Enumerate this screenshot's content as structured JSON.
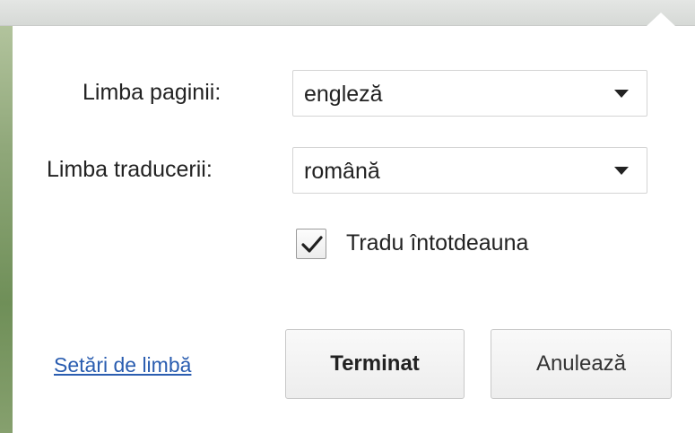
{
  "dialog": {
    "page_language_label": "Limba paginii:",
    "page_language_value": "engleză",
    "translation_language_label": "Limba traducerii:",
    "translation_language_value": "română",
    "always_translate_label": "Tradu întotdeauna",
    "always_translate_checked": true,
    "language_settings_link": "Setări de limbă",
    "done_button": "Terminat",
    "cancel_button": "Anulează"
  },
  "colors": {
    "link": "#2a5db0",
    "text": "#222222"
  },
  "icons": {
    "dropdown": "caret-down-icon",
    "checkbox": "checkmark-icon"
  }
}
